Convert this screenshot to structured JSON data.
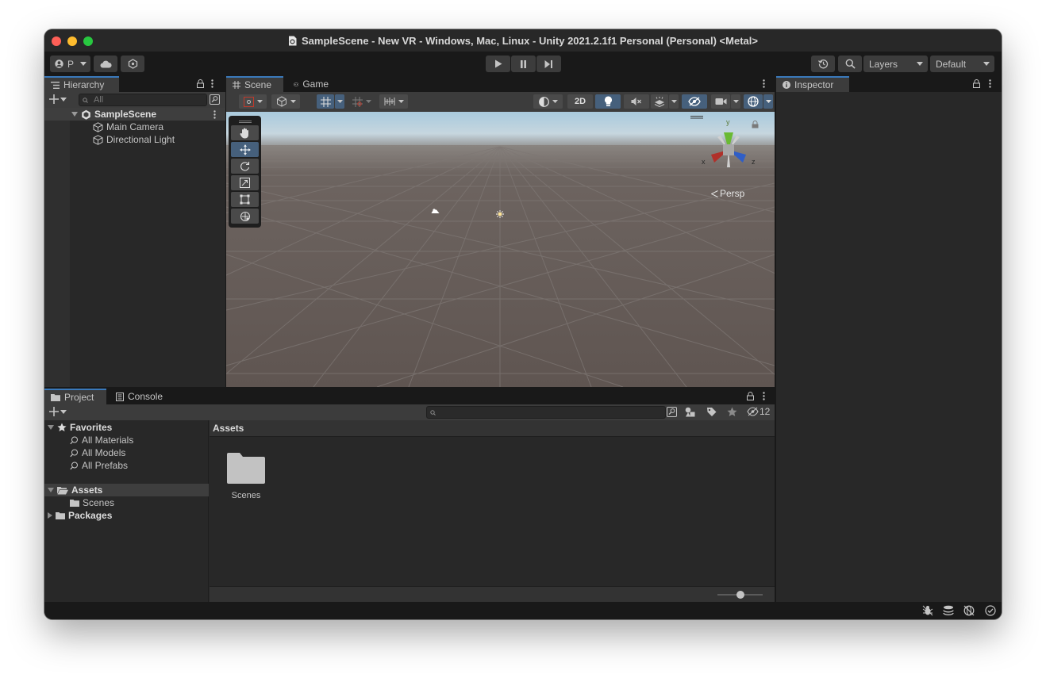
{
  "window": {
    "title": "SampleScene - New VR - Windows, Mac, Linux - Unity 2021.2.1f1 Personal (Personal) <Metal>"
  },
  "toolbar": {
    "account_label": "P",
    "play_icon": "play-icon",
    "pause_icon": "pause-icon",
    "step_icon": "step-icon",
    "layers_label": "Layers",
    "layout_label": "Default"
  },
  "hierarchy": {
    "tab_label": "Hierarchy",
    "search_placeholder": "All",
    "scene_name": "SampleScene",
    "items": [
      {
        "label": "Main Camera"
      },
      {
        "label": "Directional Light"
      }
    ]
  },
  "scene_view": {
    "tabs": [
      {
        "label": "Scene"
      },
      {
        "label": "Game"
      }
    ],
    "mode_2d_label": "2D",
    "persp_label": "Persp",
    "gizmo_axes": {
      "x": "x",
      "y": "y",
      "z": "z"
    },
    "tools": [
      "hand-tool",
      "move-tool",
      "rotate-tool",
      "scale-tool",
      "rect-tool",
      "transform-tool"
    ],
    "colors": {
      "sky_top": "#a9cadd",
      "ground": "#645a56",
      "selected": "#46607c",
      "accent": "#3a79bb"
    }
  },
  "inspector": {
    "tab_label": "Inspector"
  },
  "project": {
    "tabs": [
      {
        "label": "Project"
      },
      {
        "label": "Console"
      }
    ],
    "hidden_count": "12",
    "favorites": {
      "label": "Favorites",
      "items": [
        {
          "label": "All Materials"
        },
        {
          "label": "All Models"
        },
        {
          "label": "All Prefabs"
        }
      ]
    },
    "assets_tree": {
      "label": "Assets",
      "children": [
        {
          "label": "Scenes"
        }
      ]
    },
    "packages_label": "Packages",
    "breadcrumb": "Assets",
    "grid_items": [
      {
        "label": "Scenes",
        "icon": "folder-icon"
      }
    ],
    "zoom_level": 0.5
  }
}
